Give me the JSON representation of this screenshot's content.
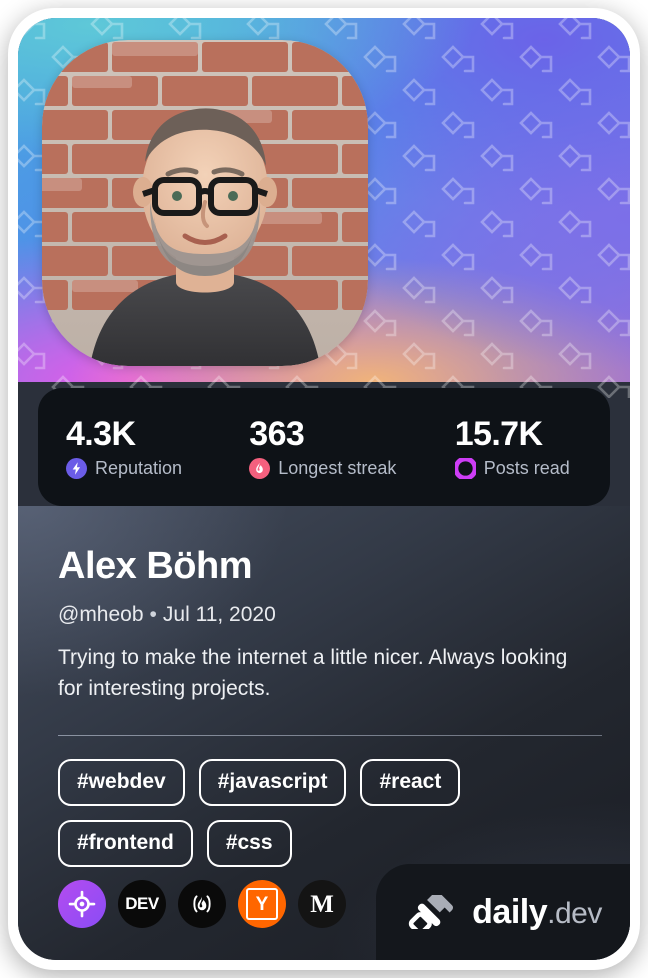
{
  "card": {
    "type": "devcard",
    "theme_colors": {
      "background_dark": "#14171c",
      "stats_panel": "#0e1217",
      "accent_reputation": "#6b5ce7",
      "accent_streak": "#f4607e",
      "accent_posts": "#cd3df5",
      "tag_border": "#ffffff",
      "brand_white": "#ffffff",
      "brand_gray": "#b7bcc6"
    }
  },
  "avatar": {
    "alt": "Profile photo of Alex Böhm",
    "icon": "user-avatar"
  },
  "stats": [
    {
      "value": "4.3K",
      "label": "Reputation",
      "icon": "bolt-icon",
      "color": "#6b5ce7"
    },
    {
      "value": "363",
      "label": "Longest streak",
      "icon": "flame-icon",
      "color": "#f4607e"
    },
    {
      "value": "15.7K",
      "label": "Posts read",
      "icon": "ring-icon",
      "color": "#cd3df5"
    }
  ],
  "profile": {
    "name": "Alex Böhm",
    "handle": "@mheob",
    "separator": "•",
    "joined_date": "Jul 11, 2020",
    "bio": "Trying to make the internet a little nicer. Always looking for interesting projects."
  },
  "tags": [
    {
      "label": "#webdev"
    },
    {
      "label": "#javascript"
    },
    {
      "label": "#react"
    },
    {
      "label": "#frontend"
    },
    {
      "label": "#css"
    }
  ],
  "socials": [
    {
      "name": "roadmap",
      "icon": "crosshair-icon",
      "glyph": ""
    },
    {
      "name": "dev-to",
      "icon": "dev-icon",
      "glyph": "DEV"
    },
    {
      "name": "hashnode",
      "icon": "flame-paren-icon",
      "glyph": ""
    },
    {
      "name": "ycombinator",
      "icon": "y-combinator-icon",
      "glyph": "Y"
    },
    {
      "name": "medium",
      "icon": "medium-icon",
      "glyph": "M"
    }
  ],
  "brand": {
    "logo_icon": "daily-dev-logo",
    "name": "daily",
    "suffix": ".dev"
  }
}
